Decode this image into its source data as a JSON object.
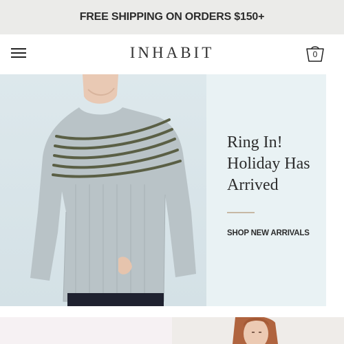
{
  "promo": {
    "text": "FREE SHIPPING ON ORDERS $150+"
  },
  "header": {
    "menu_icon": "menu-icon",
    "logo": "INHABIT",
    "cart_icon": "shopping-bag-icon",
    "cart_count": "0"
  },
  "hero": {
    "headline": "Ring In! Holiday Has Arrived",
    "cta": "SHOP NEW ARRIVALS",
    "accent_color": "#c7b8a4",
    "background_color": "#e9f2f4"
  },
  "colors": {
    "promo_background": "#ebebe9",
    "text": "#2b2b2b"
  }
}
